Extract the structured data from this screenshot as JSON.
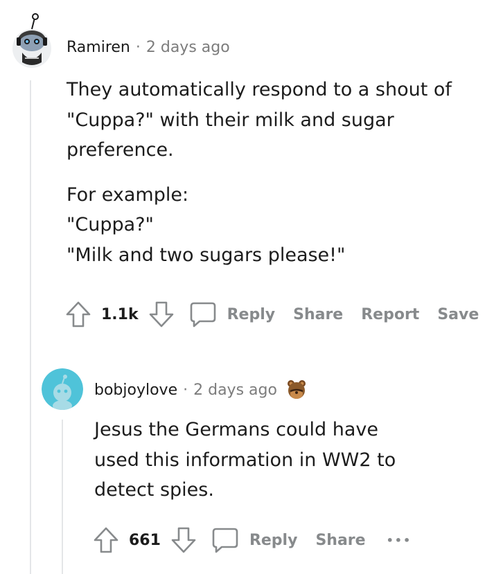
{
  "comments": [
    {
      "author": "Ramiren",
      "separator": "·",
      "time": "2 days ago",
      "paragraphs": [
        "They automatically respond to a shout of \"Cuppa?\" with their milk and sugar preference.",
        "For example:",
        "\"Cuppa?\"",
        "\"Milk and two sugars please!\""
      ],
      "score": "1.1k",
      "actions": {
        "reply": "Reply",
        "share": "Share",
        "report": "Report",
        "save": "Save"
      },
      "avatar": "snoo-avatar-with-headphones"
    },
    {
      "author": "bobjoylove",
      "separator": "·",
      "time": "2 days ago",
      "award_icon": "bear-award-icon",
      "paragraphs": [
        "Jesus the Germans could have used this information in WW2 to detect spies."
      ],
      "score": "661",
      "actions": {
        "reply": "Reply",
        "share": "Share",
        "more": "•••"
      },
      "avatar": "default-snoo-avatar",
      "avatar_color": "#4fc3d9"
    }
  ]
}
